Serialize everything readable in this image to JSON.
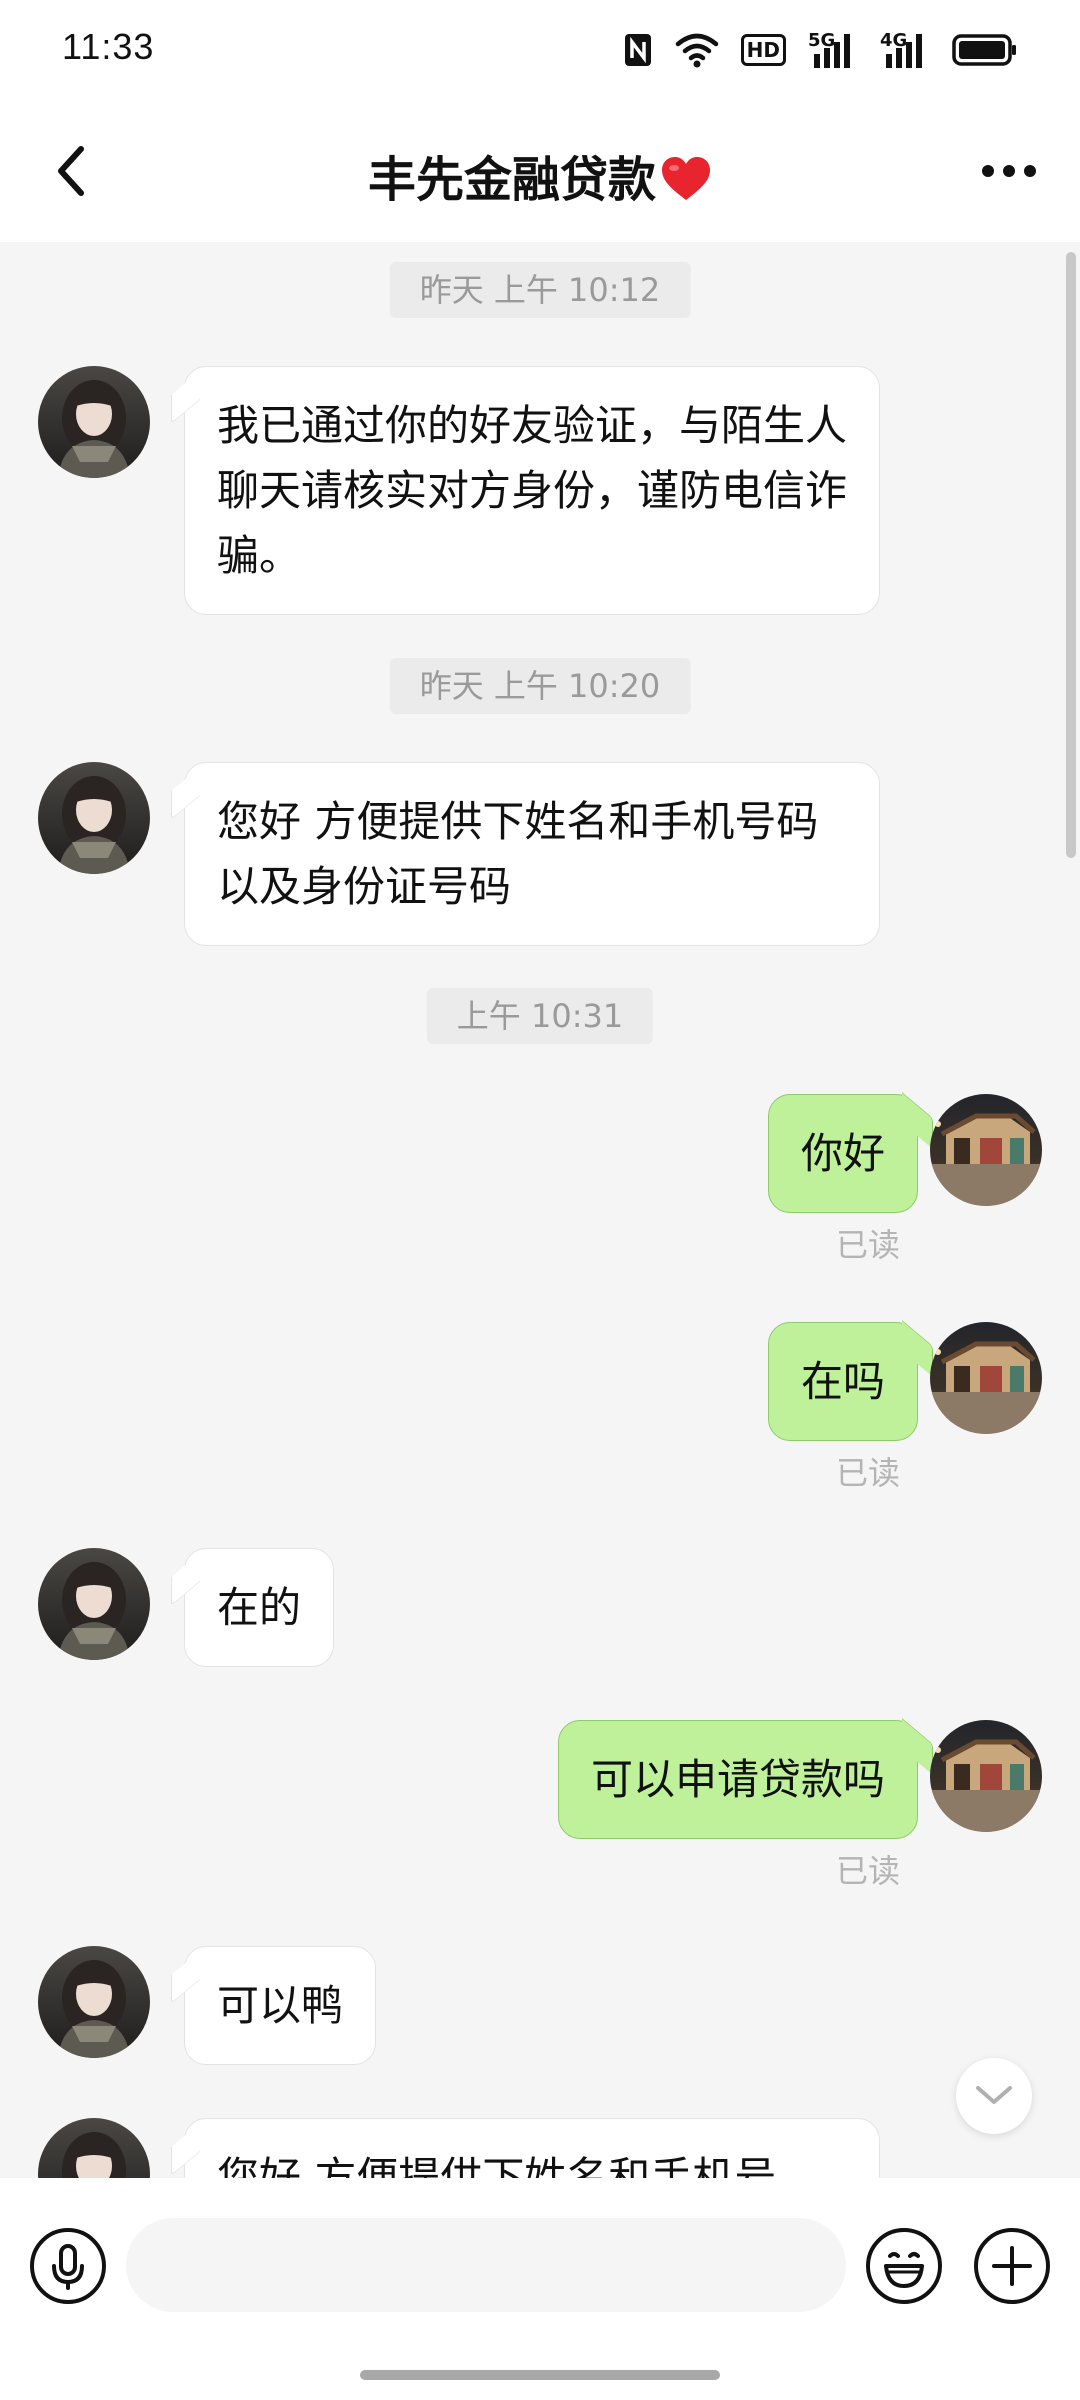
{
  "status_bar": {
    "time": "11:33",
    "icons": [
      "nfc-icon",
      "wifi-icon",
      "hd-icon",
      "signal-5g-icon",
      "signal-4g-icon",
      "battery-icon"
    ],
    "hd_label": "HD",
    "net1_label": "5G",
    "net2_label": "4G"
  },
  "header": {
    "title": "丰先金融贷款",
    "heart_color": "#e8242f"
  },
  "colors": {
    "chat_background": "#f5f5f5",
    "sent_bubble": "#bff19b",
    "received_bubble": "#ffffff"
  },
  "messages": [
    {
      "type": "timestamp",
      "text": "昨天 上午 10:12"
    },
    {
      "type": "received",
      "text": "我已通过你的好友验证，与陌生人聊天请核实对方身份，谨防电信诈骗。"
    },
    {
      "type": "timestamp",
      "text": "昨天 上午 10:20"
    },
    {
      "type": "received",
      "text": "您好 方便提供下姓名和手机号码以及身份证号码"
    },
    {
      "type": "timestamp",
      "text": "上午 10:31"
    },
    {
      "type": "sent",
      "text": "你好",
      "status": "已读"
    },
    {
      "type": "sent",
      "text": "在吗",
      "status": "已读"
    },
    {
      "type": "received",
      "text": "在的"
    },
    {
      "type": "sent",
      "text": "可以申请贷款吗",
      "status": "已读"
    },
    {
      "type": "received",
      "text": "可以鸭"
    },
    {
      "type": "received",
      "text": "您好 方便提供下姓名和手机号"
    }
  ],
  "input": {
    "value": "",
    "placeholder": ""
  }
}
